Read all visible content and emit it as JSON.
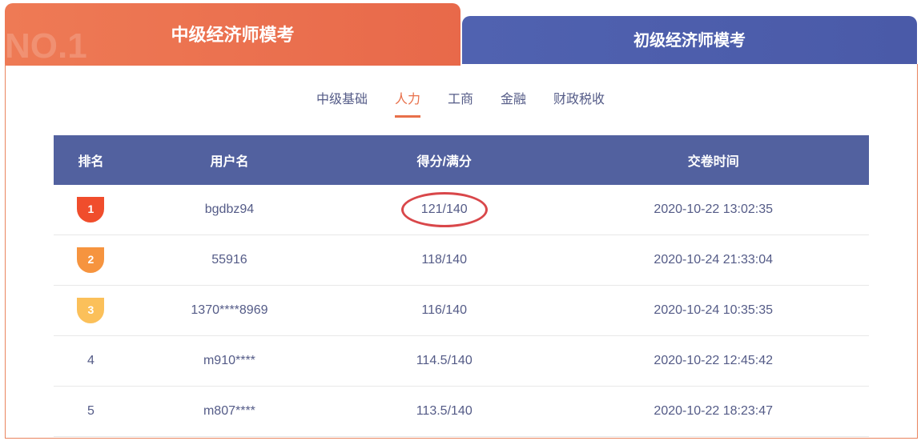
{
  "tabs": {
    "active": "中级经济师模考",
    "other": "初级经济师模考",
    "badge": "NO.1"
  },
  "subtabs": [
    "中级基础",
    "人力",
    "工商",
    "金融",
    "财政税收"
  ],
  "table": {
    "headers": [
      "排名",
      "用户名",
      "得分/满分",
      "交卷时间"
    ],
    "rows": [
      [
        "1",
        "bgdbz94",
        "121/140",
        "2020-10-22 13:02:35"
      ],
      [
        "2",
        "55916",
        "118/140",
        "2020-10-24 21:33:04"
      ],
      [
        "3",
        "1370****8969",
        "116/140",
        "2020-10-24 10:35:35"
      ],
      [
        "4",
        "m910****",
        "114.5/140",
        "2020-10-22 12:45:42"
      ],
      [
        "5",
        "m807****",
        "113.5/140",
        "2020-10-22 18:23:47"
      ]
    ]
  }
}
